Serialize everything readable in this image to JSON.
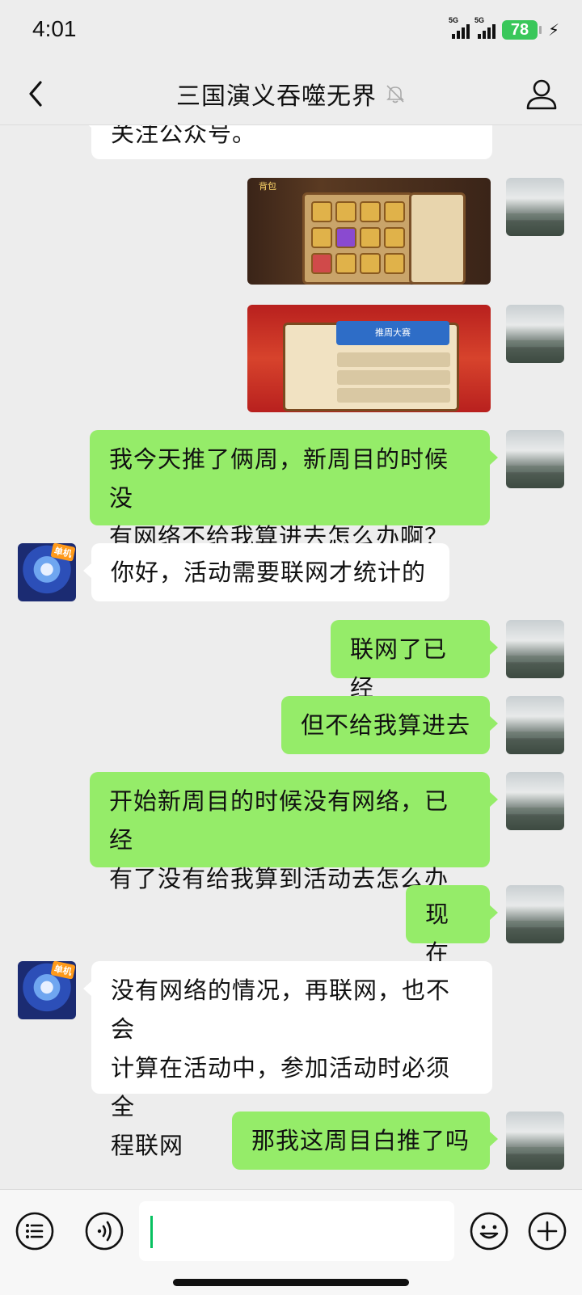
{
  "status_bar": {
    "time": "4:01",
    "network_1": "5G",
    "network_2": "5G",
    "battery": "78"
  },
  "header": {
    "title": "三国演义吞噬无界"
  },
  "messages": [
    {
      "sender": "bot",
      "kind": "text",
      "text": "关注公众号。"
    },
    {
      "sender": "me",
      "kind": "image",
      "image_caption": "背包"
    },
    {
      "sender": "me",
      "kind": "image",
      "image_caption": "推周大赛"
    },
    {
      "sender": "me",
      "kind": "text",
      "lines": [
        "我今天推了俩周，新周目的时候没",
        "有网络不给我算进去怎么办啊？"
      ]
    },
    {
      "sender": "bot",
      "kind": "text",
      "lines": [
        "你好，活动需要联网才统计的"
      ]
    },
    {
      "sender": "me",
      "kind": "text",
      "lines": [
        "联网了已经"
      ]
    },
    {
      "sender": "me",
      "kind": "text",
      "lines": [
        "但不给我算进去"
      ]
    },
    {
      "sender": "me",
      "kind": "text",
      "lines": [
        "开始新周目的时候没有网络，已经",
        "有了没有给我算到活动去怎么办"
      ]
    },
    {
      "sender": "me",
      "kind": "text",
      "lines": [
        "现在"
      ]
    },
    {
      "sender": "bot",
      "kind": "text",
      "lines": [
        "没有网络的情况，再联网，也不会",
        "计算在活动中，参加活动时必须全",
        "程联网"
      ]
    },
    {
      "sender": "me",
      "kind": "text",
      "lines": [
        "那我这周目白推了吗"
      ]
    }
  ],
  "bot_avatar_badge": "单机",
  "colors": {
    "chat_background": "#ededed",
    "my_bubble": "#95ec69",
    "their_bubble": "#ffffff",
    "battery": "#39c75a",
    "cursor": "#07c160"
  },
  "icons": {
    "back": "chevron-left-icon",
    "mute": "bell-muted-icon",
    "profile": "person-icon",
    "list": "list-icon",
    "voice": "voice-icon",
    "emoji": "emoji-icon",
    "plus": "plus-icon"
  }
}
